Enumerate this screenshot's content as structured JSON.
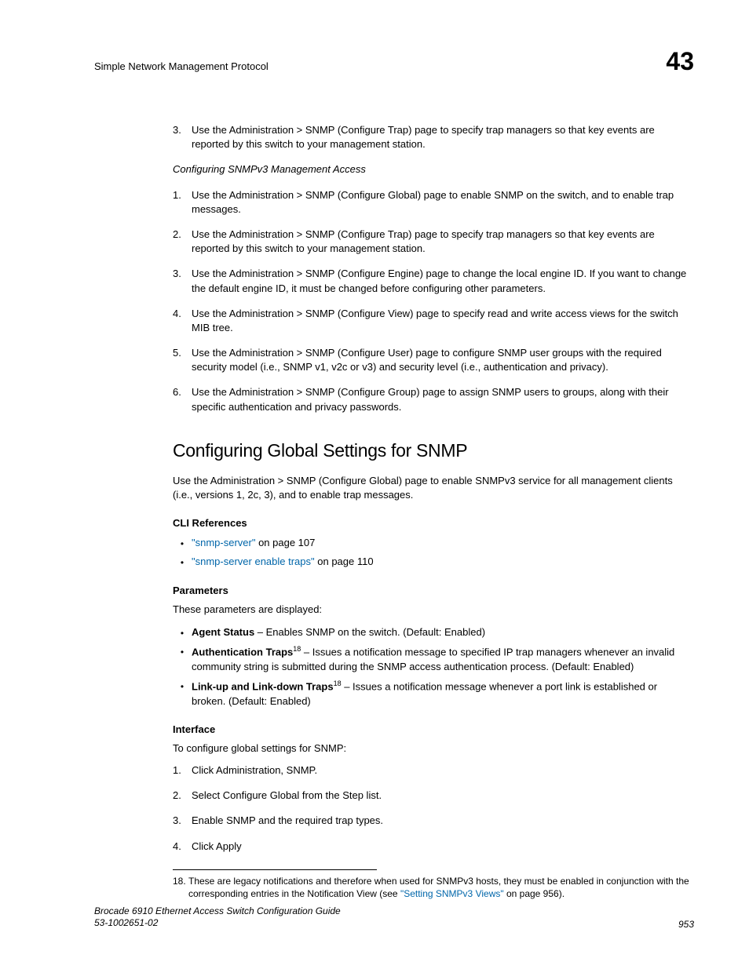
{
  "header": {
    "running_head": "Simple Network Management Protocol",
    "chapter_number": "43"
  },
  "top_list": {
    "item3_num": "3.",
    "item3_txt": "Use the Administration > SNMP (Configure Trap) page to specify trap managers so that key events are reported by this switch to your management station."
  },
  "subsection_title": "Configuring SNMPv3 Management Access",
  "v3_list": {
    "i1n": "1.",
    "i1t": "Use the Administration > SNMP (Configure Global) page to enable SNMP on the switch, and to enable trap messages.",
    "i2n": "2.",
    "i2t": "Use the Administration > SNMP (Configure Trap) page to specify trap managers so that key events are reported by this switch to your management station.",
    "i3n": "3.",
    "i3t": "Use the Administration > SNMP (Configure Engine) page to change the local engine ID. If you want to change the default engine ID, it must be changed before configuring other parameters.",
    "i4n": "4.",
    "i4t": "Use the Administration > SNMP (Configure View) page to specify read and write access views for the switch MIB tree.",
    "i5n": "5.",
    "i5t": "Use the Administration > SNMP (Configure User) page to configure SNMP user groups with the required security model (i.e., SNMP v1, v2c or v3) and security level (i.e., authentication and privacy).",
    "i6n": "6.",
    "i6t": "Use the Administration > SNMP (Configure Group) page to assign SNMP users to groups, along with their specific authentication and privacy passwords."
  },
  "section_heading": "Configuring Global Settings for SNMP",
  "section_intro": "Use the Administration > SNMP (Configure Global) page to enable SNMPv3 service for all management clients (i.e., versions 1, 2c, 3), and to enable trap messages.",
  "cli_refs": {
    "heading": "CLI References",
    "r1_link": "\"snmp-server\"",
    "r1_tail": " on page 107",
    "r2_link": "\"snmp-server enable traps\"",
    "r2_tail": " on page 110"
  },
  "parameters": {
    "heading": "Parameters",
    "intro": "These parameters are displayed:",
    "p1_bold": "Agent Status",
    "p1_rest": " – Enables SNMP on the switch. (Default: Enabled)",
    "p2_bold": "Authentication Traps",
    "p2_sup": "18",
    "p2_rest": " – Issues a notification message to specified IP trap managers whenever an invalid community string is submitted during the SNMP access authentication process. (Default: Enabled)",
    "p3_bold": "Link-up and Link-down Traps",
    "p3_sup": "18",
    "p3_rest": " – Issues a notification message whenever a port link is established or broken. (Default: Enabled)"
  },
  "interface": {
    "heading": "Interface",
    "intro": "To configure global settings for SNMP:",
    "s1n": "1.",
    "s1t": "Click Administration, SNMP.",
    "s2n": "2.",
    "s2t": "Select Configure Global from the Step list.",
    "s3n": "3.",
    "s3t": "Enable SNMP and the required trap types.",
    "s4n": "4.",
    "s4t": "Click Apply"
  },
  "footnote": {
    "num": "18.",
    "pre": "These are legacy notifications and therefore when used for SNMPv3 hosts, they must be enabled in conjunction with the corresponding entries in the Notification View (see ",
    "link": "\"Setting SNMPv3 Views\"",
    "post": " on page 956)."
  },
  "footer": {
    "line1": "Brocade 6910 Ethernet Access Switch Configuration Guide",
    "line2": "53-1002651-02",
    "page": "953"
  }
}
